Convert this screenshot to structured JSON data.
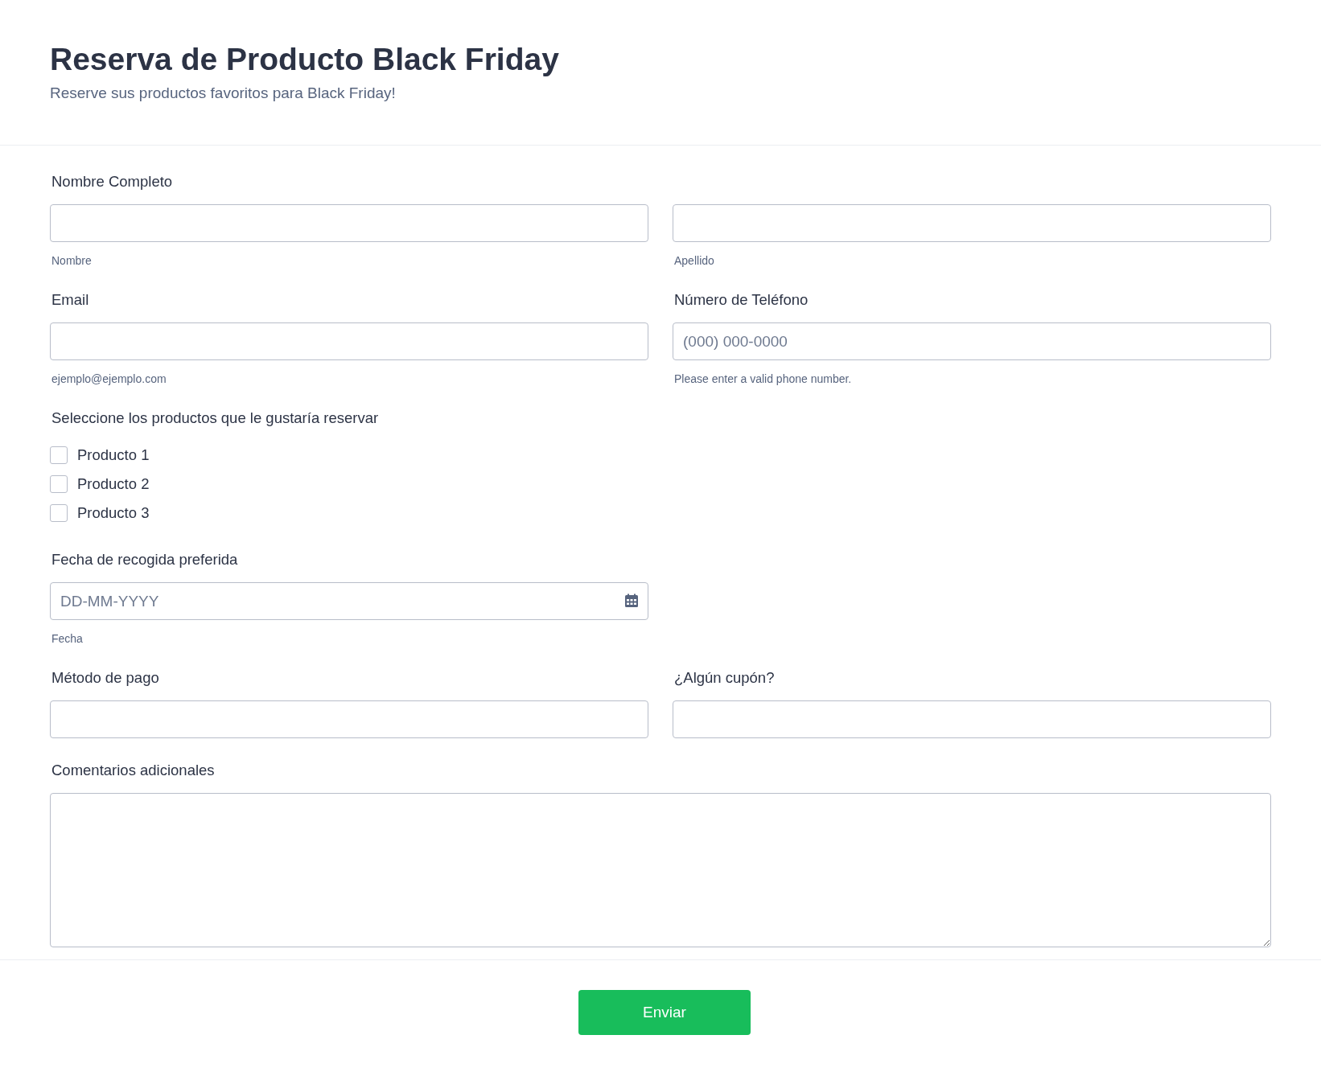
{
  "header": {
    "title": "Reserva de Producto Black Friday",
    "subtitle": "Reserve sus productos favoritos para Black Friday!"
  },
  "rows": [
    {
      "label": "Nombre Completo",
      "fields": [
        {
          "kind": "text",
          "sublabel": "Nombre"
        },
        {
          "kind": "text",
          "sublabel": "Apellido"
        }
      ]
    },
    {
      "fields": [
        {
          "kind": "text",
          "label": "Email",
          "sublabel": "ejemplo@ejemplo.com"
        },
        {
          "kind": "text",
          "label": "Número de Teléfono",
          "placeholder": "(000) 000-0000",
          "sublabel": "Please enter a valid phone number."
        }
      ]
    },
    {
      "fields": [
        {
          "kind": "checkboxes",
          "label": "Seleccione los productos que le gustaría reservar",
          "options": [
            {
              "label": "Producto 1",
              "checked": false
            },
            {
              "label": "Producto 2",
              "checked": false
            },
            {
              "label": "Producto 3",
              "checked": false
            }
          ]
        }
      ]
    },
    {
      "fields": [
        {
          "kind": "date",
          "label": "Fecha de recogida preferida",
          "placeholder": "DD-MM-YYYY",
          "sublabel": "Fecha"
        }
      ]
    },
    {
      "fields": [
        {
          "kind": "text",
          "label": "Método de pago"
        },
        {
          "kind": "text",
          "label": "¿Algún cupón?"
        }
      ]
    },
    {
      "fields": [
        {
          "kind": "textarea",
          "label": "Comentarios adicionales"
        }
      ]
    }
  ],
  "submit": {
    "label": "Enviar"
  }
}
